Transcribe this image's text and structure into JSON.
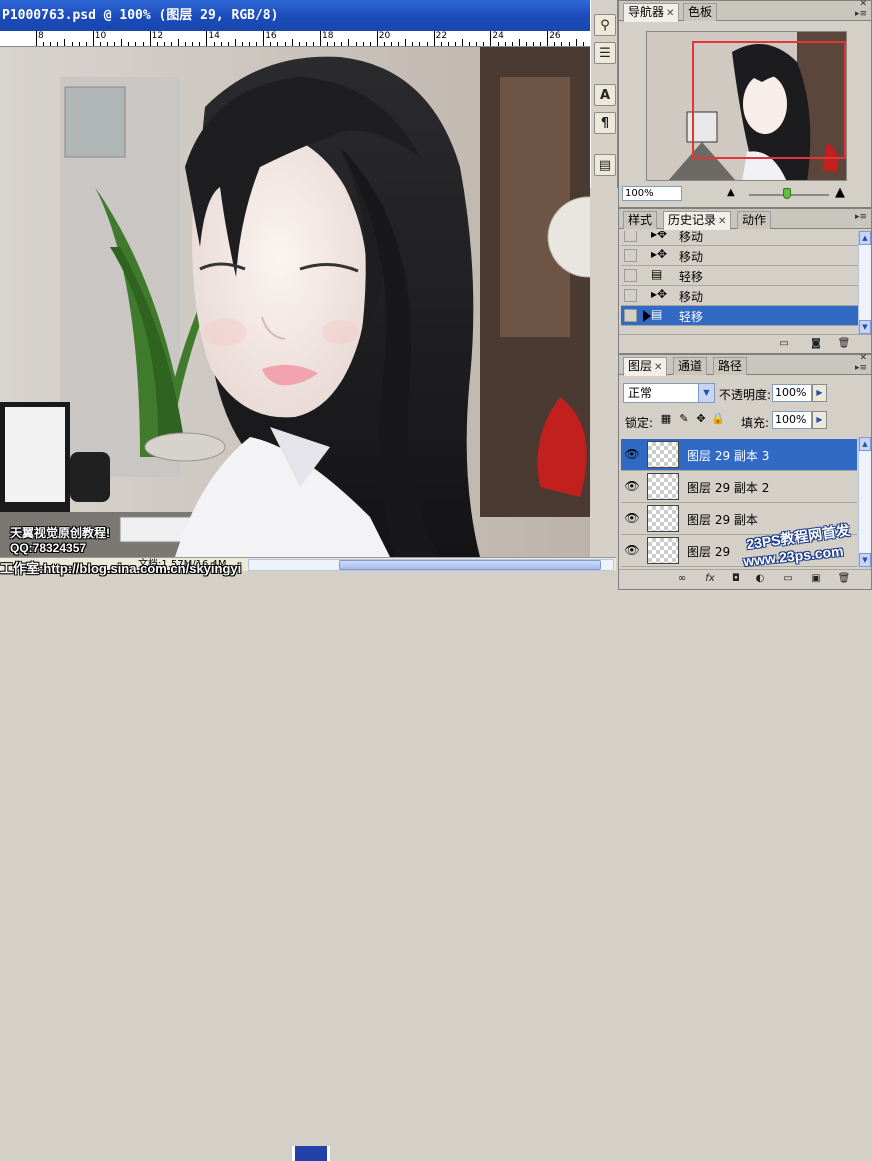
{
  "document": {
    "title": "P1000763.psd @ 100% (图层 29, RGB/8)",
    "ruler_marks": [
      "8",
      "10",
      "12",
      "14",
      "16",
      "18",
      "20",
      "22",
      "24",
      "26"
    ],
    "status_text": "文档:1.57M/16.4M"
  },
  "watermark": {
    "line1": "天翼视觉原创教程!",
    "line2": "QQ:78324357",
    "line3": "工作室:http://blog.sina.com.cn/skyingyi",
    "logo_cn": "23PS教程网首发",
    "logo_url": "www.23ps.com"
  },
  "navigator": {
    "tabs": [
      {
        "label": "导航器",
        "active": true
      },
      {
        "label": "色板",
        "active": false
      }
    ],
    "zoom_value": "100%"
  },
  "history": {
    "tabs": [
      {
        "label": "样式",
        "active": false
      },
      {
        "label": "历史记录",
        "active": true
      },
      {
        "label": "动作",
        "active": false
      }
    ],
    "items": [
      {
        "label": "移动",
        "icon": "move-icon"
      },
      {
        "label": "移动",
        "icon": "move-icon"
      },
      {
        "label": "轻移",
        "icon": "nudge-icon"
      },
      {
        "label": "移动",
        "icon": "move-icon"
      },
      {
        "label": "轻移",
        "icon": "nudge-icon",
        "selected": true
      }
    ]
  },
  "layers": {
    "tabs": [
      {
        "label": "图层",
        "active": true
      },
      {
        "label": "通道",
        "active": false
      },
      {
        "label": "路径",
        "active": false
      }
    ],
    "blend_mode": "正常",
    "opacity_label": "不透明度:",
    "opacity_value": "100%",
    "lock_label": "锁定:",
    "fill_label": "填充:",
    "fill_value": "100%",
    "items": [
      {
        "name": "图层 29 副本 3",
        "visible": true,
        "selected": true
      },
      {
        "name": "图层 29 副本 2",
        "visible": true
      },
      {
        "name": "图层 29 副本",
        "visible": true
      },
      {
        "name": "图层 29",
        "visible": true
      }
    ]
  },
  "colors": {
    "title_bar": "#1b4bb8",
    "selection": "#316ac5",
    "navigator_view_box": "#e23636"
  }
}
